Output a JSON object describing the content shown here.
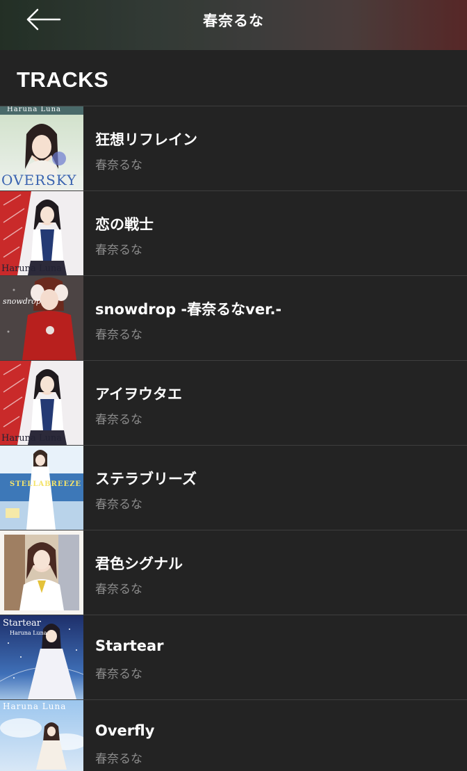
{
  "header": {
    "title": "春奈るな",
    "back_icon": "arrow-left-icon"
  },
  "section": {
    "title": "TRACKS"
  },
  "tracks": [
    {
      "title": "狂想リフレイン",
      "artist": "春奈るな",
      "cover_label": "OVERSKY",
      "cover_top": "Haruna Luna"
    },
    {
      "title": "恋の戦士",
      "artist": "春奈るな",
      "cover_label": "Haruna Luna"
    },
    {
      "title": "snowdrop -春奈るなver.-",
      "artist": "春奈るな",
      "cover_label": "snowdrop"
    },
    {
      "title": "アイヲウタエ",
      "artist": "春奈るな",
      "cover_label": "Haruna Luna"
    },
    {
      "title": "ステラブリーズ",
      "artist": "春奈るな",
      "cover_label": "STELLABREEZE"
    },
    {
      "title": "君色シグナル",
      "artist": "春奈るな"
    },
    {
      "title": "Startear",
      "artist": "春奈るな",
      "cover_label": "Startear",
      "cover_sub": "Haruna Luna"
    },
    {
      "title": "Overfly",
      "artist": "春奈るな",
      "cover_label": "Haruna Luna"
    }
  ]
}
